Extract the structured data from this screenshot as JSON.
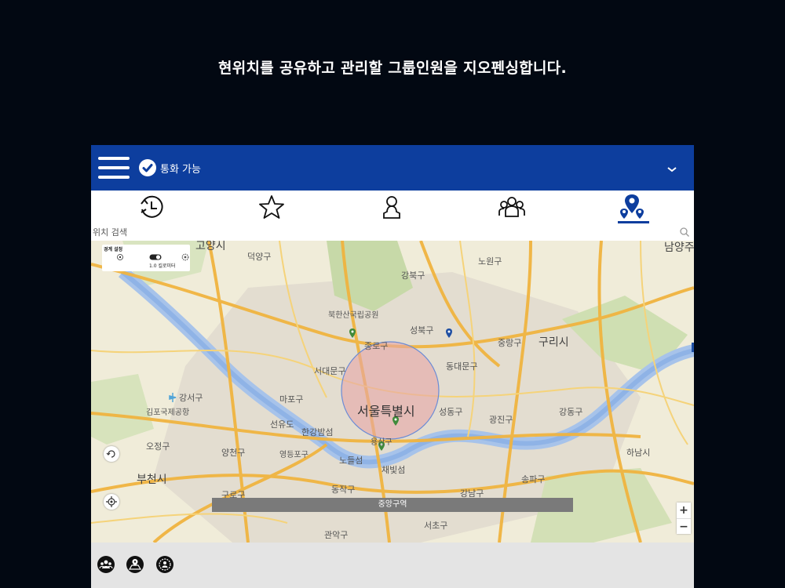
{
  "headline": "현위치를 공유하고 관리할 그룹인원을 지오펜싱합니다.",
  "topbar": {
    "status_label": "통화 가능",
    "brand_color": "#0d3e9e"
  },
  "tabs": [
    {
      "name": "history",
      "icon": "clock-history-icon"
    },
    {
      "name": "favorites",
      "icon": "star-icon"
    },
    {
      "name": "person",
      "icon": "person-icon"
    },
    {
      "name": "group",
      "icon": "group-icon"
    },
    {
      "name": "location",
      "icon": "location-pins-icon",
      "active": true
    }
  ],
  "search": {
    "placeholder": "위치 검색"
  },
  "boundary": {
    "title": "경계 설정",
    "radius": "1.0 킬로미터"
  },
  "map": {
    "labels": {
      "goyang": "고양시",
      "deogyang": "덕양구",
      "gangbuk": "강북구",
      "nowon": "노원구",
      "namyang": "남양주",
      "bukhansan": "북한산국립공원",
      "seongbuk": "성북구",
      "jongno": "종로구",
      "jungnang": "중랑구",
      "guri": "구리시",
      "seodaemun": "서대문구",
      "dongdaemun": "동대문구",
      "gangseo": "강서구",
      "mapo": "마포구",
      "gimpo": "김포국제공항",
      "seongdong": "성동구",
      "gwangjin": "광진구",
      "gangdong": "강동구",
      "seonyudo": "선유도",
      "hangangbam": "한강밤섬",
      "yangcheon": "양천구",
      "ojeong": "오정구",
      "yeongdeungpo": "영등포구",
      "nodeulseom": "노들섬",
      "chaebitseom": "채빛섬",
      "yongsan": "용산구",
      "hanam": "하남시",
      "bucheon": "부천시",
      "songpa": "송파구",
      "guro": "구로구",
      "dongjak": "동작구",
      "gangnam": "강남구",
      "seocho": "서초구",
      "gwanak": "관악구",
      "seoul": "서울특별시"
    },
    "zone_label": "중앙구역",
    "zoom_in": "+",
    "zoom_out": "−"
  },
  "bottom": [
    "group-share-icon",
    "map-person-icon",
    "settings-group-icon"
  ]
}
